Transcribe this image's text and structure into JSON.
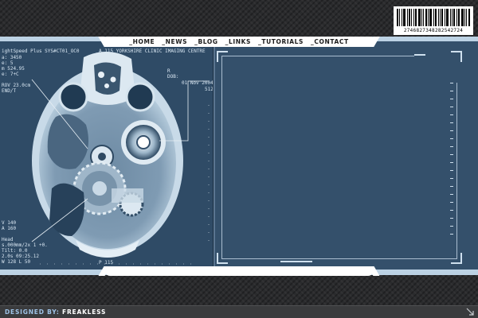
{
  "nav": {
    "items": [
      "_HOME",
      "_NEWS",
      "_BLOG",
      "_LINKS",
      "_TUTORIALS",
      "_CONTACT"
    ]
  },
  "barcode": {
    "digits": "2746827348282542724"
  },
  "scan": {
    "header_left": "ightSpeed Plus   SYS#CT01_OC0",
    "header_mid": "A 115  YORKSHIRE CLINIC IMAGING CENTRE",
    "left_lines": [
      "a: 3450",
      "e: 5",
      "m 524.95",
      "e: 7+C",
      "",
      "ROV 23.0cm",
      "END/T"
    ],
    "right_label": "R",
    "dob_label": "DOB:",
    "date": "01 Nov 2004",
    "right_number": "512",
    "bottom_lines": [
      "V 140",
      "A 160",
      "",
      "Head",
      "s.000mm/2x 1 +0.",
      "Tilt: 0.0",
      "2.0s  09:25.12",
      "W 128 L 50"
    ],
    "bottom_mark": "P 115"
  },
  "footer": {
    "credit_prefix": "DESIGNED BY:",
    "credit_name": "FREAKLESS"
  },
  "colors": {
    "panel": "#34506b",
    "bands": "#bcd2e4",
    "nav_bg": "#ffffff",
    "background": "#2a2b2d"
  },
  "icons": [
    "barcode-icon",
    "resize-grip-icon"
  ]
}
